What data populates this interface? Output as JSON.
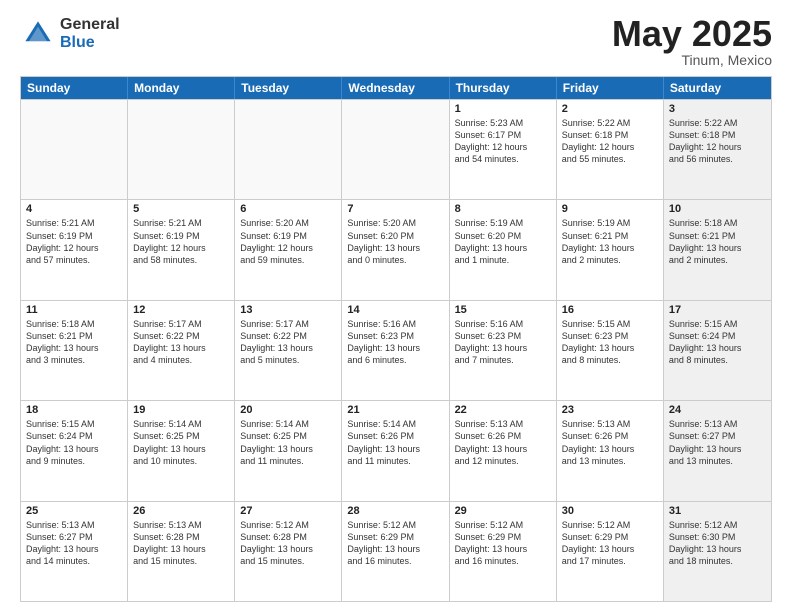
{
  "logo": {
    "general": "General",
    "blue": "Blue"
  },
  "title": "May 2025",
  "location": "Tinum, Mexico",
  "days": [
    "Sunday",
    "Monday",
    "Tuesday",
    "Wednesday",
    "Thursday",
    "Friday",
    "Saturday"
  ],
  "rows": [
    [
      {
        "day": "",
        "empty": true
      },
      {
        "day": "",
        "empty": true
      },
      {
        "day": "",
        "empty": true
      },
      {
        "day": "",
        "empty": true
      },
      {
        "day": "1",
        "lines": [
          "Sunrise: 5:23 AM",
          "Sunset: 6:17 PM",
          "Daylight: 12 hours",
          "and 54 minutes."
        ]
      },
      {
        "day": "2",
        "lines": [
          "Sunrise: 5:22 AM",
          "Sunset: 6:18 PM",
          "Daylight: 12 hours",
          "and 55 minutes."
        ]
      },
      {
        "day": "3",
        "shaded": true,
        "lines": [
          "Sunrise: 5:22 AM",
          "Sunset: 6:18 PM",
          "Daylight: 12 hours",
          "and 56 minutes."
        ]
      }
    ],
    [
      {
        "day": "4",
        "lines": [
          "Sunrise: 5:21 AM",
          "Sunset: 6:19 PM",
          "Daylight: 12 hours",
          "and 57 minutes."
        ]
      },
      {
        "day": "5",
        "lines": [
          "Sunrise: 5:21 AM",
          "Sunset: 6:19 PM",
          "Daylight: 12 hours",
          "and 58 minutes."
        ]
      },
      {
        "day": "6",
        "lines": [
          "Sunrise: 5:20 AM",
          "Sunset: 6:19 PM",
          "Daylight: 12 hours",
          "and 59 minutes."
        ]
      },
      {
        "day": "7",
        "lines": [
          "Sunrise: 5:20 AM",
          "Sunset: 6:20 PM",
          "Daylight: 13 hours",
          "and 0 minutes."
        ]
      },
      {
        "day": "8",
        "lines": [
          "Sunrise: 5:19 AM",
          "Sunset: 6:20 PM",
          "Daylight: 13 hours",
          "and 1 minute."
        ]
      },
      {
        "day": "9",
        "lines": [
          "Sunrise: 5:19 AM",
          "Sunset: 6:21 PM",
          "Daylight: 13 hours",
          "and 2 minutes."
        ]
      },
      {
        "day": "10",
        "shaded": true,
        "lines": [
          "Sunrise: 5:18 AM",
          "Sunset: 6:21 PM",
          "Daylight: 13 hours",
          "and 2 minutes."
        ]
      }
    ],
    [
      {
        "day": "11",
        "lines": [
          "Sunrise: 5:18 AM",
          "Sunset: 6:21 PM",
          "Daylight: 13 hours",
          "and 3 minutes."
        ]
      },
      {
        "day": "12",
        "lines": [
          "Sunrise: 5:17 AM",
          "Sunset: 6:22 PM",
          "Daylight: 13 hours",
          "and 4 minutes."
        ]
      },
      {
        "day": "13",
        "lines": [
          "Sunrise: 5:17 AM",
          "Sunset: 6:22 PM",
          "Daylight: 13 hours",
          "and 5 minutes."
        ]
      },
      {
        "day": "14",
        "lines": [
          "Sunrise: 5:16 AM",
          "Sunset: 6:23 PM",
          "Daylight: 13 hours",
          "and 6 minutes."
        ]
      },
      {
        "day": "15",
        "lines": [
          "Sunrise: 5:16 AM",
          "Sunset: 6:23 PM",
          "Daylight: 13 hours",
          "and 7 minutes."
        ]
      },
      {
        "day": "16",
        "lines": [
          "Sunrise: 5:15 AM",
          "Sunset: 6:23 PM",
          "Daylight: 13 hours",
          "and 8 minutes."
        ]
      },
      {
        "day": "17",
        "shaded": true,
        "lines": [
          "Sunrise: 5:15 AM",
          "Sunset: 6:24 PM",
          "Daylight: 13 hours",
          "and 8 minutes."
        ]
      }
    ],
    [
      {
        "day": "18",
        "lines": [
          "Sunrise: 5:15 AM",
          "Sunset: 6:24 PM",
          "Daylight: 13 hours",
          "and 9 minutes."
        ]
      },
      {
        "day": "19",
        "lines": [
          "Sunrise: 5:14 AM",
          "Sunset: 6:25 PM",
          "Daylight: 13 hours",
          "and 10 minutes."
        ]
      },
      {
        "day": "20",
        "lines": [
          "Sunrise: 5:14 AM",
          "Sunset: 6:25 PM",
          "Daylight: 13 hours",
          "and 11 minutes."
        ]
      },
      {
        "day": "21",
        "lines": [
          "Sunrise: 5:14 AM",
          "Sunset: 6:26 PM",
          "Daylight: 13 hours",
          "and 11 minutes."
        ]
      },
      {
        "day": "22",
        "lines": [
          "Sunrise: 5:13 AM",
          "Sunset: 6:26 PM",
          "Daylight: 13 hours",
          "and 12 minutes."
        ]
      },
      {
        "day": "23",
        "lines": [
          "Sunrise: 5:13 AM",
          "Sunset: 6:26 PM",
          "Daylight: 13 hours",
          "and 13 minutes."
        ]
      },
      {
        "day": "24",
        "shaded": true,
        "lines": [
          "Sunrise: 5:13 AM",
          "Sunset: 6:27 PM",
          "Daylight: 13 hours",
          "and 13 minutes."
        ]
      }
    ],
    [
      {
        "day": "25",
        "lines": [
          "Sunrise: 5:13 AM",
          "Sunset: 6:27 PM",
          "Daylight: 13 hours",
          "and 14 minutes."
        ]
      },
      {
        "day": "26",
        "lines": [
          "Sunrise: 5:13 AM",
          "Sunset: 6:28 PM",
          "Daylight: 13 hours",
          "and 15 minutes."
        ]
      },
      {
        "day": "27",
        "lines": [
          "Sunrise: 5:12 AM",
          "Sunset: 6:28 PM",
          "Daylight: 13 hours",
          "and 15 minutes."
        ]
      },
      {
        "day": "28",
        "lines": [
          "Sunrise: 5:12 AM",
          "Sunset: 6:29 PM",
          "Daylight: 13 hours",
          "and 16 minutes."
        ]
      },
      {
        "day": "29",
        "lines": [
          "Sunrise: 5:12 AM",
          "Sunset: 6:29 PM",
          "Daylight: 13 hours",
          "and 16 minutes."
        ]
      },
      {
        "day": "30",
        "lines": [
          "Sunrise: 5:12 AM",
          "Sunset: 6:29 PM",
          "Daylight: 13 hours",
          "and 17 minutes."
        ]
      },
      {
        "day": "31",
        "shaded": true,
        "lines": [
          "Sunrise: 5:12 AM",
          "Sunset: 6:30 PM",
          "Daylight: 13 hours",
          "and 18 minutes."
        ]
      }
    ]
  ]
}
